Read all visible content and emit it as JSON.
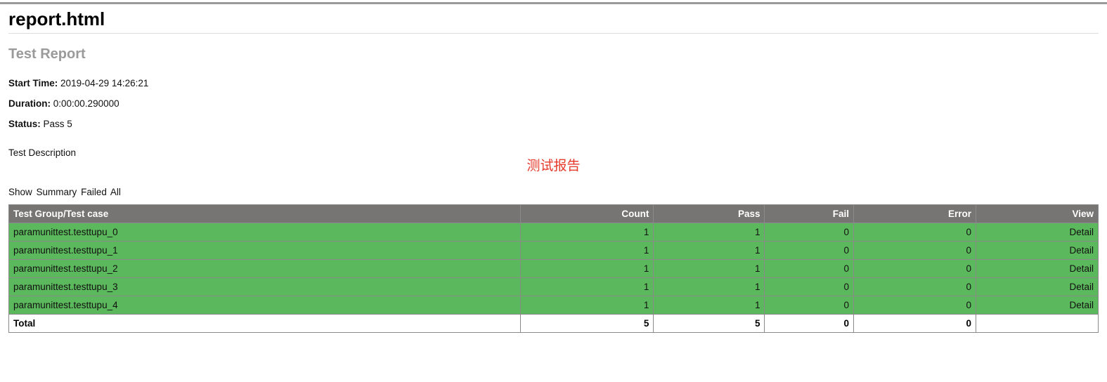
{
  "page_title": "report.html",
  "report_heading": "Test Report",
  "meta": {
    "start_time_label": "Start Time:",
    "start_time_value": "2019-04-29 14:26:21",
    "duration_label": "Duration:",
    "duration_value": "0:00:00.290000",
    "status_label": "Status:",
    "status_value": "Pass 5"
  },
  "description_label": "Test Description",
  "annotation_text": "测试报告",
  "view_links": {
    "prefix": "Show",
    "summary": "Summary",
    "failed": "Failed",
    "all": "All"
  },
  "table": {
    "headers": {
      "name": "Test Group/Test case",
      "count": "Count",
      "pass": "Pass",
      "fail": "Fail",
      "error": "Error",
      "view": "View"
    },
    "rows": [
      {
        "name": "paramunittest.testtupu_0",
        "count": 1,
        "pass": 1,
        "fail": 0,
        "error": 0,
        "view": "Detail"
      },
      {
        "name": "paramunittest.testtupu_1",
        "count": 1,
        "pass": 1,
        "fail": 0,
        "error": 0,
        "view": "Detail"
      },
      {
        "name": "paramunittest.testtupu_2",
        "count": 1,
        "pass": 1,
        "fail": 0,
        "error": 0,
        "view": "Detail"
      },
      {
        "name": "paramunittest.testtupu_3",
        "count": 1,
        "pass": 1,
        "fail": 0,
        "error": 0,
        "view": "Detail"
      },
      {
        "name": "paramunittest.testtupu_4",
        "count": 1,
        "pass": 1,
        "fail": 0,
        "error": 0,
        "view": "Detail"
      }
    ],
    "total": {
      "label": "Total",
      "count": 5,
      "pass": 5,
      "fail": 0,
      "error": 0,
      "view": ""
    }
  }
}
